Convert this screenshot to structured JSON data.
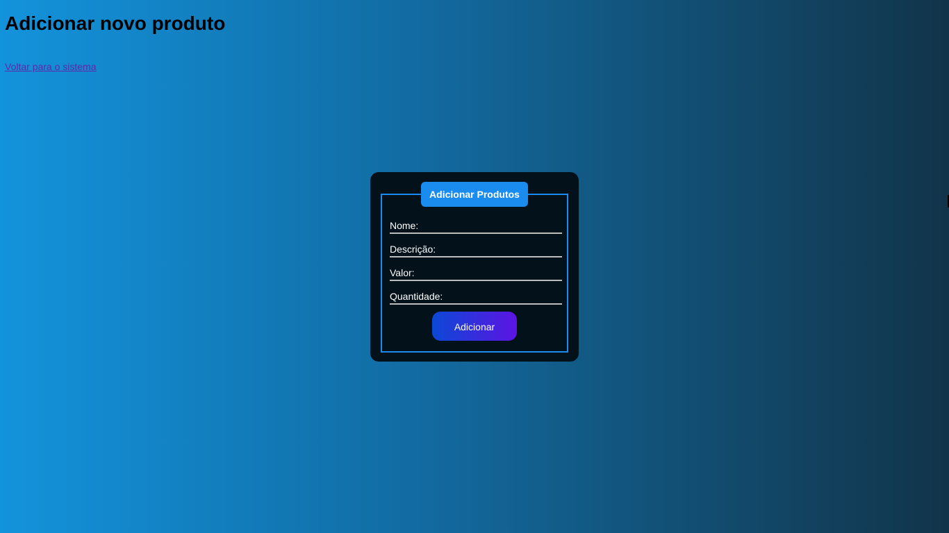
{
  "page": {
    "heading": "Adicionar novo produto",
    "back_link": "Voltar para o sistema"
  },
  "form": {
    "legend": "Adicionar Produtos",
    "fields": [
      {
        "label": "Nome:",
        "value": ""
      },
      {
        "label": "Descrição:",
        "value": ""
      },
      {
        "label": "Valor:",
        "value": ""
      },
      {
        "label": "Quantidade:",
        "value": ""
      }
    ],
    "submit_label": "Adicionar"
  },
  "colors": {
    "background_start": "#1393dc",
    "background_end": "#11344a",
    "card": "#03111a",
    "accent": "#1a8bef",
    "button_start": "#0c48d6",
    "button_end": "#5c14e3",
    "link": "#5a2aa8"
  }
}
